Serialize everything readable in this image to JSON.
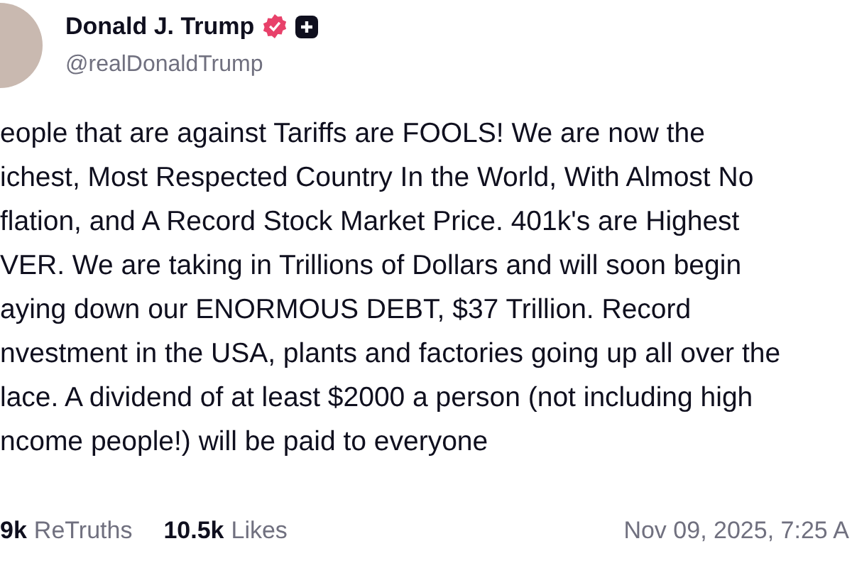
{
  "author": {
    "name": "Donald J. Trump",
    "verified": true,
    "handle": "@realDonaldTrump"
  },
  "post_lines": [
    "eople that are against Tariffs are FOOLS! We are now the",
    "ichest, Most Respected Country In the World, With Almost No",
    "flation, and A Record Stock Market Price. 401k's are Highest",
    "VER. We are taking in Trillions of Dollars and will soon begin",
    "aying down our ENORMOUS DEBT, $37 Trillion. Record",
    "nvestment in the USA, plants and factories going up all over the",
    "lace. A dividend of at least $2000 a person (not including high",
    "ncome people!) will be paid to everyone"
  ],
  "stats": [
    {
      "count": "9k",
      "label": "ReTruths"
    },
    {
      "count": "10.5k",
      "label": "Likes"
    }
  ],
  "timestamp": "Nov 09, 2025, 7:25 A"
}
